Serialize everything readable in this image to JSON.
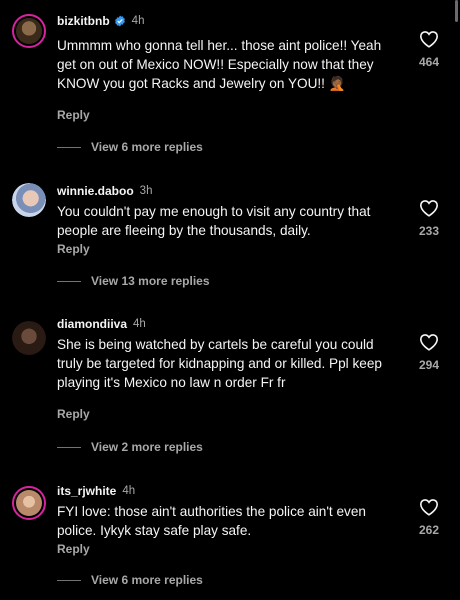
{
  "comments": [
    {
      "username": "bizkitbnb",
      "verified": true,
      "time": "4h",
      "text": "Ummmm who gonna tell her... those aint police!! Yeah get on out of Mexico NOW!! Especially now that they KNOW you got Racks and Jewelry on YOU!! 🤦🏾",
      "reply": "Reply",
      "view_replies": "View 6 more replies",
      "likes": "464"
    },
    {
      "username": "winnie.daboo",
      "verified": false,
      "time": "3h",
      "text": "You couldn't pay me enough to visit any country that people are fleeing by the thousands, daily.",
      "reply": "Reply",
      "view_replies": "View 13 more replies",
      "likes": "233"
    },
    {
      "username": "diamondiiva",
      "verified": false,
      "time": "4h",
      "text": "She is being watched by cartels be careful you could truly be targeted for kidnapping and or killed. Ppl keep playing it's Mexico no law n order Fr fr",
      "reply": "Reply",
      "view_replies": "View 2 more replies",
      "likes": "294"
    },
    {
      "username": "its_rjwhite",
      "verified": false,
      "time": "4h",
      "text": "FYI love: those ain't authorities the police ain't even police. Iykyk stay safe play safe.",
      "reply": "Reply",
      "view_replies": "View 6 more replies",
      "likes": "262"
    }
  ],
  "icons": {
    "like": "heart-outline-icon",
    "verified": "verified-badge-icon"
  },
  "colors": {
    "background": "#000000",
    "primary_text": "#f5f5f5",
    "secondary_text": "#a8a8a8",
    "verified": "#3897f0",
    "story_ring": "#d6249f"
  }
}
